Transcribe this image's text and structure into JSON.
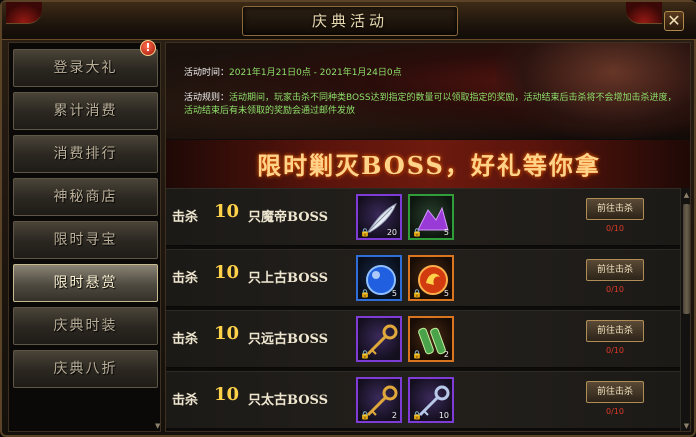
{
  "window": {
    "title": "庆典活动"
  },
  "sidebar": {
    "alert_badge": "!",
    "items": [
      {
        "label": "登录大礼"
      },
      {
        "label": "累计消费"
      },
      {
        "label": "消费排行"
      },
      {
        "label": "神秘商店"
      },
      {
        "label": "限时寻宝"
      },
      {
        "label": "限时悬赏",
        "active": true
      },
      {
        "label": "庆典时装"
      },
      {
        "label": "庆典八折"
      }
    ]
  },
  "event": {
    "time_label": "活动时间：",
    "time_value": "2021年1月21日0点 - 2021年1月24日0点",
    "rule_label": "活动规则：",
    "rule_value": "活动期间，玩家击杀不同种类BOSS达到指定的数量可以领取指定的奖励，活动结束后击杀将不会增加击杀进度，活动结束后有未领取的奖励会通过邮件发放"
  },
  "banner": {
    "text": "限时剿灭BOSS，好礼等你拿"
  },
  "tasks": [
    {
      "kill": "击杀",
      "count": "10",
      "boss": "只魔帝BOSS",
      "rewards": [
        {
          "icon": "feather-icon",
          "quality": "purple",
          "qty": "20"
        },
        {
          "icon": "crystal-pile-icon",
          "quality": "green",
          "qty": "5"
        }
      ],
      "button": "前往击杀",
      "progress": "0/10"
    },
    {
      "kill": "击杀",
      "count": "10",
      "boss": "只上古BOSS",
      "rewards": [
        {
          "icon": "blue-orb-icon",
          "quality": "blue",
          "qty": "5"
        },
        {
          "icon": "fire-orb-icon",
          "quality": "orange",
          "qty": "5"
        }
      ],
      "button": "前往击杀",
      "progress": "0/10"
    },
    {
      "kill": "击杀",
      "count": "10",
      "boss": "只远古BOSS",
      "rewards": [
        {
          "icon": "golden-key-icon",
          "quality": "purple",
          "qty": ""
        },
        {
          "icon": "jade-scroll-icon",
          "quality": "orange",
          "qty": "2"
        }
      ],
      "button": "前往击杀",
      "progress": "0/10"
    },
    {
      "kill": "击杀",
      "count": "10",
      "boss": "只太古BOSS",
      "rewards": [
        {
          "icon": "golden-key-icon",
          "quality": "purple",
          "qty": "2"
        },
        {
          "icon": "silver-key-icon",
          "quality": "purple",
          "qty": "10"
        }
      ],
      "button": "前往击杀",
      "progress": "0/10"
    }
  ],
  "colors": {
    "accent_gold": "#ffd24a",
    "rule_green": "#8ee06a",
    "progress_red": "#e23a2a"
  }
}
